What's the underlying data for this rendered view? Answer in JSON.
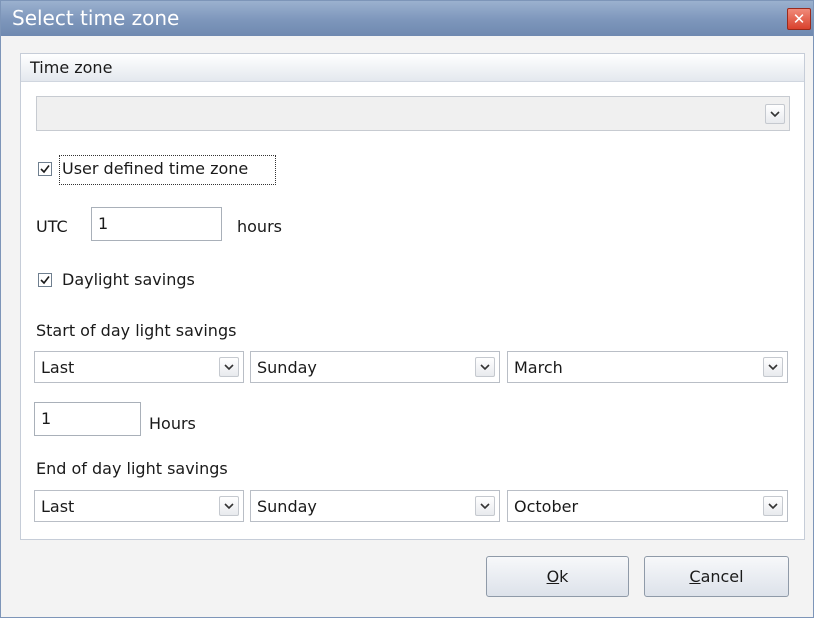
{
  "window": {
    "title": "Select time zone",
    "close_glyph": "✕"
  },
  "group": {
    "header": "Time zone"
  },
  "timezone_combo": {
    "value": ""
  },
  "user_defined": {
    "label": "User defined time zone",
    "checked": true
  },
  "utc": {
    "label": "UTC",
    "value": "1",
    "unit": "hours"
  },
  "daylight": {
    "label": "Daylight savings",
    "checked": true
  },
  "start": {
    "label": "Start of day light savings",
    "week": "Last",
    "day": "Sunday",
    "month": "March",
    "hours_value": "1",
    "hours_label": "Hours"
  },
  "end": {
    "label": "End of day light savings",
    "week": "Last",
    "day": "Sunday",
    "month": "October"
  },
  "buttons": {
    "ok_mnemonic": "O",
    "ok_rest": "k",
    "cancel_mnemonic": "C",
    "cancel_rest": "ancel"
  },
  "colors": {
    "titlebar": "#7d96bb",
    "close": "#d9412c",
    "check": "#1a1a1a"
  },
  "icons": [
    "close-icon",
    "chevron-down-icon",
    "checkmark-icon"
  ]
}
